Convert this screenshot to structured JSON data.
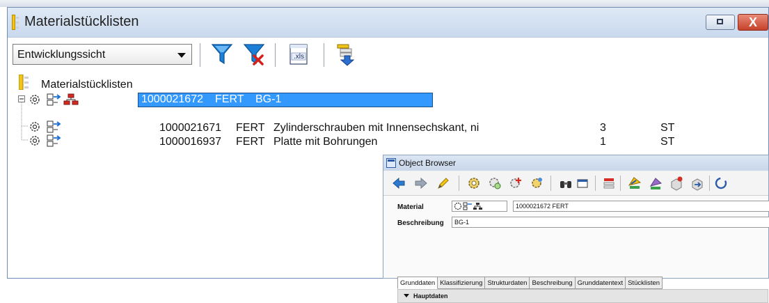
{
  "window": {
    "title": "Materialstücklisten",
    "restore_label": "",
    "close_label": "X"
  },
  "toolbar": {
    "view_select": "Entwicklungssicht",
    "xls_label": ".xls"
  },
  "tree": {
    "root_label": "Materialstücklisten",
    "selected": {
      "number": "1000021672",
      "type": "FERT",
      "name": "BG-1"
    },
    "children": [
      {
        "number": "1000021671",
        "type": "FERT",
        "name": "Zylinderschrauben mit Innensechskant, ni",
        "qty": "3",
        "unit": "ST"
      },
      {
        "number": "1000016937",
        "type": "FERT",
        "name": "Platte mit Bohrungen",
        "qty": "1",
        "unit": "ST"
      }
    ]
  },
  "object_browser": {
    "title": "Object Browser",
    "material_label": "Material",
    "material_value": "1000021672 FERT",
    "description_label": "Beschreibung",
    "description_value": "BG-1",
    "tabs": [
      "Grunddaten",
      "Klassifizierung",
      "Strukturdaten",
      "Beschreibung",
      "Grunddatentext",
      "Stücklisten"
    ],
    "section": "Hauptdaten"
  },
  "colors": {
    "selection": "#3399ff",
    "title_bar": "#cfdcee",
    "close_button": "#c6412a"
  }
}
